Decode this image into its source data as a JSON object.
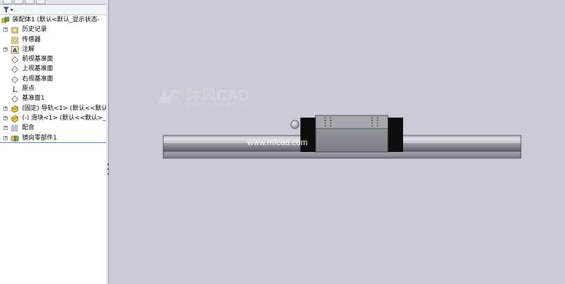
{
  "feature_tree": {
    "root": "装配体1 (默认<默认_显示状态-",
    "items": [
      {
        "label": "历史记录",
        "icon": "history-folder-icon",
        "expandable": true
      },
      {
        "label": "传感器",
        "icon": "sensor-icon",
        "expandable": false
      },
      {
        "label": "注解",
        "icon": "annotation-icon",
        "expandable": true
      },
      {
        "label": "前视基准面",
        "icon": "plane-icon",
        "expandable": false
      },
      {
        "label": "上视基准面",
        "icon": "plane-icon",
        "expandable": false
      },
      {
        "label": "右视基准面",
        "icon": "plane-icon",
        "expandable": false
      },
      {
        "label": "原点",
        "icon": "origin-icon",
        "expandable": false
      },
      {
        "label": "基准面1",
        "icon": "plane-icon",
        "expandable": false
      },
      {
        "label": "(固定) 导轨<1> (默认<<默认",
        "icon": "part-icon",
        "expandable": true
      },
      {
        "label": "(-) 滑块<1> (默认<<默认>_",
        "icon": "part-icon",
        "expandable": true
      },
      {
        "label": "配合",
        "icon": "mates-icon",
        "expandable": true
      },
      {
        "label": "镜向零部件1",
        "icon": "mirror-icon",
        "expandable": true
      }
    ]
  },
  "watermark": {
    "brand": "沐风CAD",
    "url": "WWW.mfcad.com"
  },
  "overlay_url": "www.mfcad.com",
  "colors": {
    "viewport_bg": "#c9cbd6",
    "rail": "#8e9097",
    "block": "#8d8e93",
    "end_cap": "#0d0d0d",
    "selection_line": "#5a7fc2"
  }
}
